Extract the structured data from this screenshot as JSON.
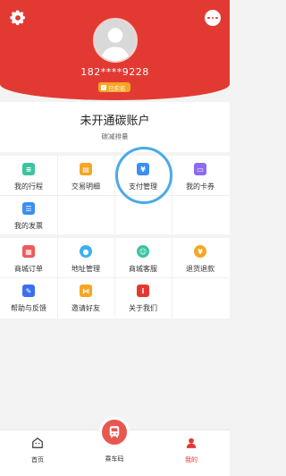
{
  "profile": {
    "phone": "182****9228",
    "badge": "已实名"
  },
  "carbon": {
    "title": "未开通碳账户",
    "subtitle": "碳减排量"
  },
  "services": [
    {
      "label": "我的行程",
      "icon": "trip-icon",
      "color": "#3cc4a0"
    },
    {
      "label": "交易明细",
      "icon": "transaction-icon",
      "color": "#f5a623"
    },
    {
      "label": "支付管理",
      "icon": "payment-icon",
      "color": "#3b8ff0"
    },
    {
      "label": "我的卡券",
      "icon": "coupon-icon",
      "color": "#8b6cf0"
    },
    {
      "label": "我的发票",
      "icon": "invoice-icon",
      "color": "#3b8ff0"
    }
  ],
  "more": [
    {
      "label": "商城订单",
      "icon": "shop-order-icon",
      "color": "#ee5a5a"
    },
    {
      "label": "地址管理",
      "icon": "address-icon",
      "color": "#3bb0f0"
    },
    {
      "label": "商城客服",
      "icon": "service-icon",
      "color": "#3cc4a0"
    },
    {
      "label": "退货退款",
      "icon": "refund-icon",
      "color": "#f5a623"
    },
    {
      "label": "帮助与反馈",
      "icon": "help-icon",
      "color": "#3b6ff0"
    },
    {
      "label": "邀请好友",
      "icon": "invite-icon",
      "color": "#f5a623"
    },
    {
      "label": "关于我们",
      "icon": "about-icon",
      "color": "#e23a33"
    }
  ],
  "tabs": {
    "home": "首页",
    "ride": "乘车码",
    "mine": "我的"
  },
  "colors": {
    "brand": "#e23a33",
    "highlight": "#4aa9e9"
  }
}
